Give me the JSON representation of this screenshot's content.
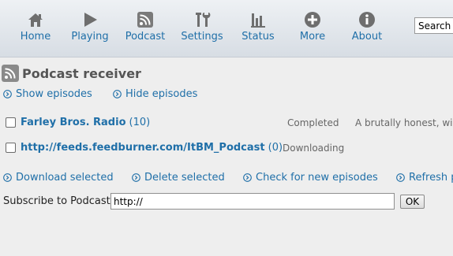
{
  "nav": {
    "home": "Home",
    "playing": "Playing",
    "podcast": "Podcast",
    "settings": "Settings",
    "status": "Status",
    "more": "More",
    "about": "About"
  },
  "search": {
    "value": "Search"
  },
  "page": {
    "title": "Podcast receiver"
  },
  "actions": {
    "show_episodes": "Show episodes",
    "hide_episodes": "Hide episodes",
    "download_selected": "Download selected",
    "delete_selected": "Delete selected",
    "check_new": "Check for new episodes",
    "refresh": "Refresh p"
  },
  "feeds": [
    {
      "title": "Farley Bros. Radio",
      "count": "(10)",
      "status": "Completed",
      "description": "A brutally honest, wic"
    },
    {
      "title": "http://feeds.feedburner.com/ItBM_Podcast",
      "count": "(0)",
      "status": "Downloading",
      "description": ""
    }
  ],
  "subscribe": {
    "label": "Subscribe to Podcast",
    "value": "http://",
    "ok": "OK"
  },
  "colors": {
    "link": "#1f6fa8",
    "icon": "#6e6e6e",
    "nav_bg": "#dde2e8"
  }
}
